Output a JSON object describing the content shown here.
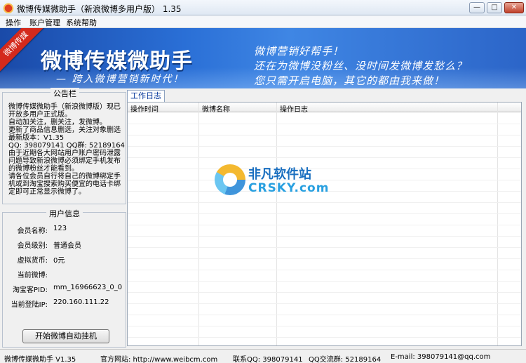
{
  "window": {
    "title": "微博传媒微助手（新浪微博多用户版） 1.35",
    "minimize_label": "—",
    "maximize_label": "□",
    "close_label": "✕"
  },
  "menu": {
    "items": [
      "操作",
      "账户管理",
      "系统帮助"
    ]
  },
  "banner": {
    "ribbon": "微博传媒",
    "title": "微博传媒微助手",
    "subtitle": "— 跨入微博营销新时代！",
    "slogans": [
      "微博营销好帮手！",
      "还在为微博没粉丝、没时间发微博发愁么？",
      "您只需开启电脑，其它的都由我来做！"
    ]
  },
  "notice": {
    "title": "公告栏",
    "lines": [
      "微博传媒微助手（新浪微博版）现已",
      "开放多用户正式版。",
      "自动加关注，删关注，发微博。",
      "更新了商品信息删选，关注对象删选",
      "最新版本：V1.35",
      "QQ: 398079141  QQ群: 52189164",
      "由于近期各大网站用户账户密码泄露",
      "问题导致新浪微博必须绑定手机发布",
      "的微博粉丝才能看到。",
      "请各位会员自行将自己的微博绑定手",
      "机或到淘宝搜索购买便宜的电话卡绑",
      "定即可正常显示微博了。"
    ]
  },
  "user_info": {
    "title": "用户信息",
    "rows": [
      {
        "label": "会员名称:",
        "value": "123"
      },
      {
        "label": "会员级别:",
        "value": "普通会员"
      },
      {
        "label": "虚拟货币:",
        "value": "0元"
      },
      {
        "label": "当前微博:",
        "value": ""
      },
      {
        "label": "淘宝客PID:",
        "value": "mm_16966623_0_0"
      },
      {
        "label": "当前登陆IP:",
        "value": "220.160.111.22"
      }
    ],
    "start_button": "开始微博自动挂机"
  },
  "log": {
    "tab": "工作日志",
    "columns": [
      "操作时间",
      "微博名称",
      "操作日志"
    ]
  },
  "watermark": {
    "cn": "非凡软件站",
    "en": "CRSKY.com"
  },
  "status": {
    "app": "微博传媒微助手 V1.35",
    "website": "官方网站: http://www.weibcm.com",
    "qq": "联系QQ: 398079141",
    "qq_group": "QQ交流群: 52189164",
    "email": "E-mail: 398079141@qq.com"
  },
  "colors": {
    "banner": "#2a6fd6",
    "ribbon": "#d42a1c",
    "tab_text": "#003399"
  }
}
